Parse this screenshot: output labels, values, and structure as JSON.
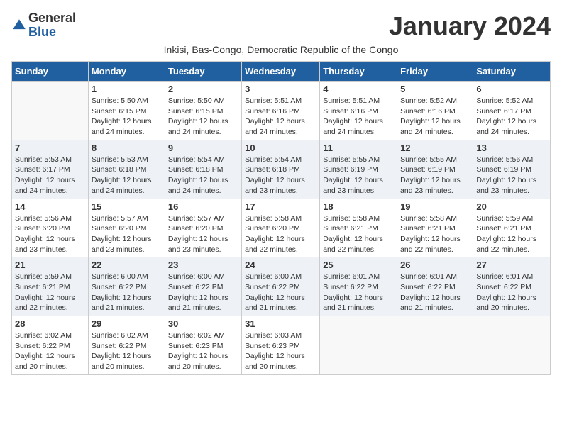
{
  "header": {
    "logo_general": "General",
    "logo_blue": "Blue",
    "month_title": "January 2024",
    "subtitle": "Inkisi, Bas-Congo, Democratic Republic of the Congo"
  },
  "days_of_week": [
    "Sunday",
    "Monday",
    "Tuesday",
    "Wednesday",
    "Thursday",
    "Friday",
    "Saturday"
  ],
  "weeks": [
    [
      {
        "day": "",
        "sunrise": "",
        "sunset": "",
        "daylight": ""
      },
      {
        "day": "1",
        "sunrise": "Sunrise: 5:50 AM",
        "sunset": "Sunset: 6:15 PM",
        "daylight": "Daylight: 12 hours and 24 minutes."
      },
      {
        "day": "2",
        "sunrise": "Sunrise: 5:50 AM",
        "sunset": "Sunset: 6:15 PM",
        "daylight": "Daylight: 12 hours and 24 minutes."
      },
      {
        "day": "3",
        "sunrise": "Sunrise: 5:51 AM",
        "sunset": "Sunset: 6:16 PM",
        "daylight": "Daylight: 12 hours and 24 minutes."
      },
      {
        "day": "4",
        "sunrise": "Sunrise: 5:51 AM",
        "sunset": "Sunset: 6:16 PM",
        "daylight": "Daylight: 12 hours and 24 minutes."
      },
      {
        "day": "5",
        "sunrise": "Sunrise: 5:52 AM",
        "sunset": "Sunset: 6:16 PM",
        "daylight": "Daylight: 12 hours and 24 minutes."
      },
      {
        "day": "6",
        "sunrise": "Sunrise: 5:52 AM",
        "sunset": "Sunset: 6:17 PM",
        "daylight": "Daylight: 12 hours and 24 minutes."
      }
    ],
    [
      {
        "day": "7",
        "sunrise": "Sunrise: 5:53 AM",
        "sunset": "Sunset: 6:17 PM",
        "daylight": "Daylight: 12 hours and 24 minutes."
      },
      {
        "day": "8",
        "sunrise": "Sunrise: 5:53 AM",
        "sunset": "Sunset: 6:18 PM",
        "daylight": "Daylight: 12 hours and 24 minutes."
      },
      {
        "day": "9",
        "sunrise": "Sunrise: 5:54 AM",
        "sunset": "Sunset: 6:18 PM",
        "daylight": "Daylight: 12 hours and 24 minutes."
      },
      {
        "day": "10",
        "sunrise": "Sunrise: 5:54 AM",
        "sunset": "Sunset: 6:18 PM",
        "daylight": "Daylight: 12 hours and 23 minutes."
      },
      {
        "day": "11",
        "sunrise": "Sunrise: 5:55 AM",
        "sunset": "Sunset: 6:19 PM",
        "daylight": "Daylight: 12 hours and 23 minutes."
      },
      {
        "day": "12",
        "sunrise": "Sunrise: 5:55 AM",
        "sunset": "Sunset: 6:19 PM",
        "daylight": "Daylight: 12 hours and 23 minutes."
      },
      {
        "day": "13",
        "sunrise": "Sunrise: 5:56 AM",
        "sunset": "Sunset: 6:19 PM",
        "daylight": "Daylight: 12 hours and 23 minutes."
      }
    ],
    [
      {
        "day": "14",
        "sunrise": "Sunrise: 5:56 AM",
        "sunset": "Sunset: 6:20 PM",
        "daylight": "Daylight: 12 hours and 23 minutes."
      },
      {
        "day": "15",
        "sunrise": "Sunrise: 5:57 AM",
        "sunset": "Sunset: 6:20 PM",
        "daylight": "Daylight: 12 hours and 23 minutes."
      },
      {
        "day": "16",
        "sunrise": "Sunrise: 5:57 AM",
        "sunset": "Sunset: 6:20 PM",
        "daylight": "Daylight: 12 hours and 23 minutes."
      },
      {
        "day": "17",
        "sunrise": "Sunrise: 5:58 AM",
        "sunset": "Sunset: 6:20 PM",
        "daylight": "Daylight: 12 hours and 22 minutes."
      },
      {
        "day": "18",
        "sunrise": "Sunrise: 5:58 AM",
        "sunset": "Sunset: 6:21 PM",
        "daylight": "Daylight: 12 hours and 22 minutes."
      },
      {
        "day": "19",
        "sunrise": "Sunrise: 5:58 AM",
        "sunset": "Sunset: 6:21 PM",
        "daylight": "Daylight: 12 hours and 22 minutes."
      },
      {
        "day": "20",
        "sunrise": "Sunrise: 5:59 AM",
        "sunset": "Sunset: 6:21 PM",
        "daylight": "Daylight: 12 hours and 22 minutes."
      }
    ],
    [
      {
        "day": "21",
        "sunrise": "Sunrise: 5:59 AM",
        "sunset": "Sunset: 6:21 PM",
        "daylight": "Daylight: 12 hours and 22 minutes."
      },
      {
        "day": "22",
        "sunrise": "Sunrise: 6:00 AM",
        "sunset": "Sunset: 6:22 PM",
        "daylight": "Daylight: 12 hours and 21 minutes."
      },
      {
        "day": "23",
        "sunrise": "Sunrise: 6:00 AM",
        "sunset": "Sunset: 6:22 PM",
        "daylight": "Daylight: 12 hours and 21 minutes."
      },
      {
        "day": "24",
        "sunrise": "Sunrise: 6:00 AM",
        "sunset": "Sunset: 6:22 PM",
        "daylight": "Daylight: 12 hours and 21 minutes."
      },
      {
        "day": "25",
        "sunrise": "Sunrise: 6:01 AM",
        "sunset": "Sunset: 6:22 PM",
        "daylight": "Daylight: 12 hours and 21 minutes."
      },
      {
        "day": "26",
        "sunrise": "Sunrise: 6:01 AM",
        "sunset": "Sunset: 6:22 PM",
        "daylight": "Daylight: 12 hours and 21 minutes."
      },
      {
        "day": "27",
        "sunrise": "Sunrise: 6:01 AM",
        "sunset": "Sunset: 6:22 PM",
        "daylight": "Daylight: 12 hours and 20 minutes."
      }
    ],
    [
      {
        "day": "28",
        "sunrise": "Sunrise: 6:02 AM",
        "sunset": "Sunset: 6:22 PM",
        "daylight": "Daylight: 12 hours and 20 minutes."
      },
      {
        "day": "29",
        "sunrise": "Sunrise: 6:02 AM",
        "sunset": "Sunset: 6:22 PM",
        "daylight": "Daylight: 12 hours and 20 minutes."
      },
      {
        "day": "30",
        "sunrise": "Sunrise: 6:02 AM",
        "sunset": "Sunset: 6:23 PM",
        "daylight": "Daylight: 12 hours and 20 minutes."
      },
      {
        "day": "31",
        "sunrise": "Sunrise: 6:03 AM",
        "sunset": "Sunset: 6:23 PM",
        "daylight": "Daylight: 12 hours and 20 minutes."
      },
      {
        "day": "",
        "sunrise": "",
        "sunset": "",
        "daylight": ""
      },
      {
        "day": "",
        "sunrise": "",
        "sunset": "",
        "daylight": ""
      },
      {
        "day": "",
        "sunrise": "",
        "sunset": "",
        "daylight": ""
      }
    ]
  ]
}
